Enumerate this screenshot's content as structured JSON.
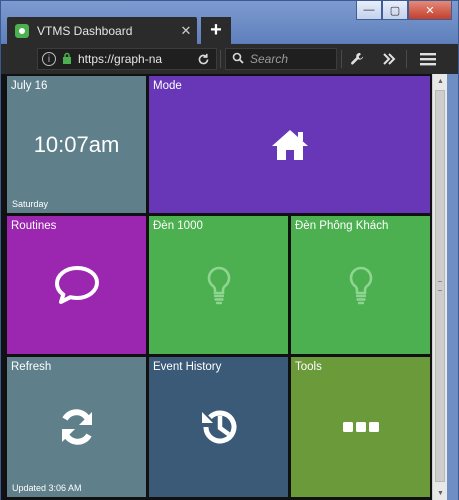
{
  "browser": {
    "tab_title": "VTMS Dashboard",
    "tab_close": "✕",
    "new_tab": "+",
    "url": "https://graph-na",
    "search_placeholder": "Search"
  },
  "window_controls": {
    "minimize": "—",
    "maximize": "▢",
    "close": "✕"
  },
  "tiles": {
    "clock": {
      "date": "July 16",
      "time": "10:07am",
      "day": "Saturday",
      "color": "#5f7f8a"
    },
    "mode": {
      "label": "Mode",
      "icon": "home-icon",
      "color": "#6737b8"
    },
    "routines": {
      "label": "Routines",
      "icon": "chat-bubble-icon",
      "color": "#9b27b0"
    },
    "den1000": {
      "label": "Đèn 1000",
      "icon": "lightbulb-icon",
      "color": "#4caf50"
    },
    "den_phong_khach": {
      "label": "Đèn Phông Khách",
      "icon": "lightbulb-icon",
      "color": "#4caf50"
    },
    "refresh": {
      "label": "Refresh",
      "footer": "Updated 3:06 AM",
      "icon": "refresh-icon",
      "color": "#5f7f8a"
    },
    "event_history": {
      "label": "Event History",
      "icon": "history-icon",
      "color": "#3a5a78"
    },
    "tools": {
      "label": "Tools",
      "icon": "more-dots-icon",
      "color": "#6a9a3a"
    }
  }
}
